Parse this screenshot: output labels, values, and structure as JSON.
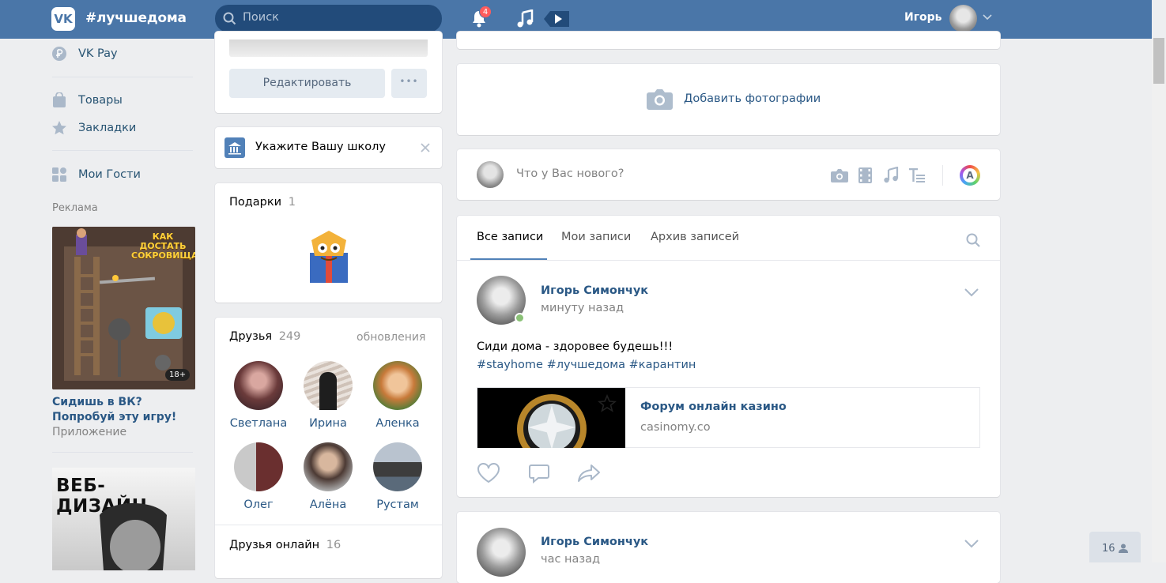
{
  "header": {
    "hashtag": "#лучшедома",
    "search_placeholder": "Поиск",
    "notifications_count": "4",
    "user_name": "Игорь",
    "accent": "#4a76a8"
  },
  "left_menu": {
    "items": [
      {
        "label": "VK Pay",
        "icon": "ruble-icon"
      },
      {
        "label": "Товары",
        "icon": "bag-icon"
      },
      {
        "label": "Закладки",
        "icon": "star-icon"
      },
      {
        "label": "Мои Гости",
        "icon": "apps-icon"
      }
    ],
    "ads_title": "Реклама",
    "ad1": {
      "banner_text": "КАК ДОСТАТЬ СОКРОВИЩА?",
      "age": "18+",
      "title": "Сидишь в ВК? Попробуй эту игру!",
      "subtitle": "Приложение"
    },
    "ad2": {
      "banner_text": "ВЕБ-ДИЗАЙН"
    }
  },
  "profile": {
    "edit_label": "Редактировать",
    "more_label": "•••",
    "school_prompt": "Укажите Вашу школу",
    "gifts_label": "Подарки",
    "gifts_count": "1",
    "friends_label": "Друзья",
    "friends_count": "249",
    "updates_label": "обновления",
    "friends": [
      {
        "name": "Светлана"
      },
      {
        "name": "Ирина"
      },
      {
        "name": "Аленка"
      },
      {
        "name": "Олег"
      },
      {
        "name": "Алёна"
      },
      {
        "name": "Рустам"
      }
    ],
    "online_label": "Друзья онлайн",
    "online_count": "16"
  },
  "feed": {
    "add_photos": "Добавить фотографии",
    "composer_placeholder": "Что у Вас нового?",
    "composer_avatar_letter": "A",
    "tabs": [
      "Все записи",
      "Мои записи",
      "Архив записей"
    ],
    "post1": {
      "author": "Игорь Симончук",
      "time": "минуту назад",
      "text": "Сиди дома - здоровее будешь!!!",
      "hashtags": "#stayhome #лучшедома #карантин",
      "link_title": "Форум онлайн казино",
      "link_domain": "casinomy.co"
    },
    "post2": {
      "author": "Игорь Симончук",
      "time": "час назад"
    }
  },
  "chat_badge": "16"
}
